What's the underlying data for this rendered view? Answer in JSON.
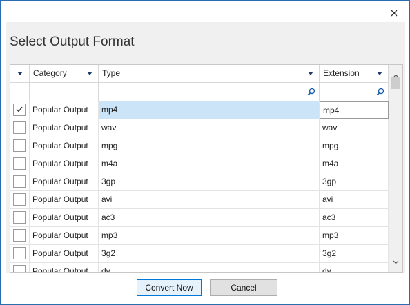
{
  "window": {
    "title": "Select Output Format",
    "close_icon": "close-icon"
  },
  "grid": {
    "columns": [
      {
        "key": "select",
        "label": ""
      },
      {
        "key": "category",
        "label": "Category"
      },
      {
        "key": "type",
        "label": "Type"
      },
      {
        "key": "extension",
        "label": "Extension"
      }
    ],
    "rows": [
      {
        "checked": true,
        "category": "Popular Output",
        "type": "mp4",
        "extension": "mp4"
      },
      {
        "checked": false,
        "category": "Popular Output",
        "type": "wav",
        "extension": "wav"
      },
      {
        "checked": false,
        "category": "Popular Output",
        "type": "mpg",
        "extension": "mpg"
      },
      {
        "checked": false,
        "category": "Popular Output",
        "type": "m4a",
        "extension": "m4a"
      },
      {
        "checked": false,
        "category": "Popular Output",
        "type": "3gp",
        "extension": "3gp"
      },
      {
        "checked": false,
        "category": "Popular Output",
        "type": "avi",
        "extension": "avi"
      },
      {
        "checked": false,
        "category": "Popular Output",
        "type": "ac3",
        "extension": "ac3"
      },
      {
        "checked": false,
        "category": "Popular Output",
        "type": "mp3",
        "extension": "mp3"
      },
      {
        "checked": false,
        "category": "Popular Output",
        "type": "3g2",
        "extension": "3g2"
      },
      {
        "checked": false,
        "category": "Popular Output",
        "type": "dv",
        "extension": "dv"
      }
    ]
  },
  "buttons": {
    "convert": "Convert Now",
    "cancel": "Cancel"
  },
  "colors": {
    "accent": "#0078d7",
    "selection": "#cce4f7",
    "border": "#2b6cb0"
  }
}
